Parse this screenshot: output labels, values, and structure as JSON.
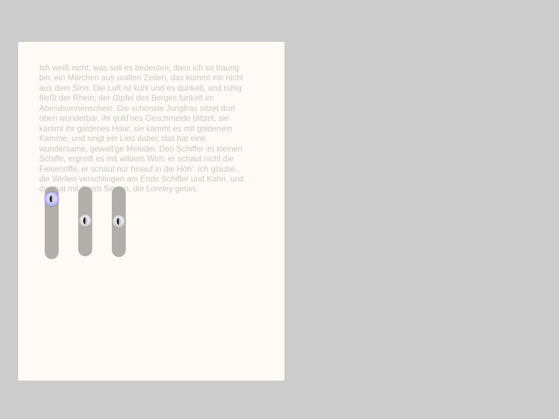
{
  "document": {
    "text": "Ich weiß nicht, was soll es bedeuten, dass ich so traurig bin, ein Märchen aus uralten Zeiten, das kommt mir nicht aus dem Sinn. Die Luft ist kühl und es dunkelt, und ruhig fließt der Rhein; der Gipfel des Berges funkelt im Abendsonnenschein. Die schönste Jungfrau sitzet dort oben wunderbar, ihr gold'nes Geschmeide blitzet, sie kämmt ihr goldenes Haar, sie kämmt es mit goldenem Kamme, und singt ein Lied dabei; das hat eine wundersame, gewalt'ge Melodei. Den Schiffer im kleinen Schiffe, ergreift es mit wildem Weh; er schaut nicht die Felsenriffe, er schaut nur hinauf in die Höh'. Ich glaube, die Wellen verschlingen am Ende Schiffer und Kahn, und das hat mit ihrem Singen, die Loreley getan."
  },
  "sliders": [
    {
      "value": 0.09,
      "state": "active"
    },
    {
      "value": 0.49,
      "state": "normal"
    },
    {
      "value": 0.49,
      "state": "normal"
    }
  ],
  "colors": {
    "desktop": "#cccccc",
    "page": "#fffaf6",
    "text": "#c8c8c8",
    "track": "#b1afab",
    "active_thumb": "#c8c6ff"
  }
}
